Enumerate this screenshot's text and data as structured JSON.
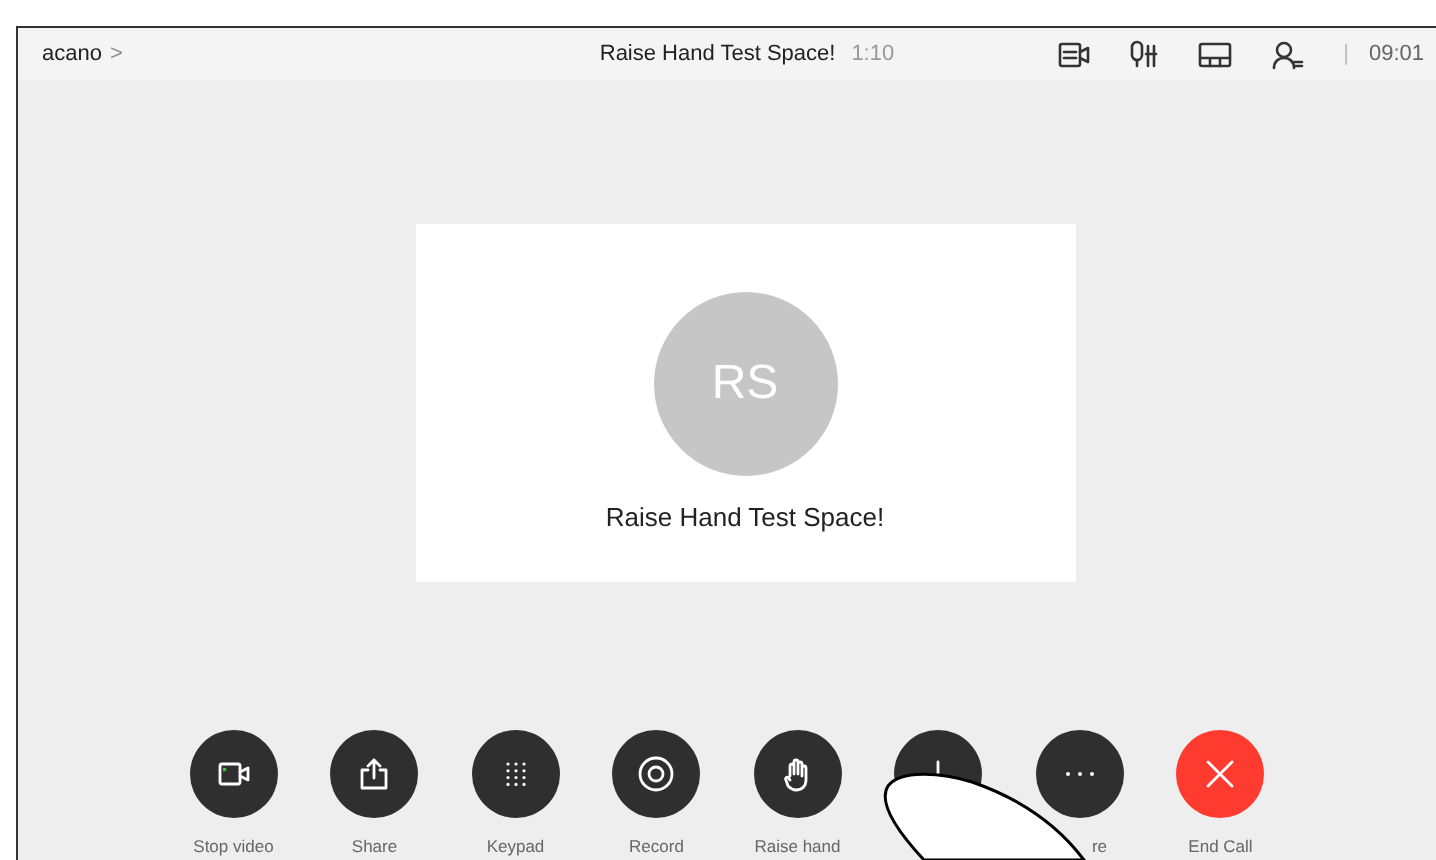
{
  "top_bar": {
    "breadcrumb": "acano",
    "breadcrumb_arrow": ">",
    "title": "Raise Hand Test Space!",
    "duration": "1:10",
    "separator": "|",
    "time": "09:01"
  },
  "call_card": {
    "initials": "RS",
    "name": "Raise Hand Test Space!"
  },
  "buttons": [
    {
      "kind": "video",
      "label": "Stop video"
    },
    {
      "kind": "share",
      "label": "Share"
    },
    {
      "kind": "keypad",
      "label": "Keypad"
    },
    {
      "kind": "record",
      "label": "Record"
    },
    {
      "kind": "hand",
      "label": "Raise hand"
    },
    {
      "kind": "add"
    },
    {
      "kind": "more",
      "label": "re"
    },
    {
      "kind": "end",
      "label": "End Call"
    }
  ]
}
